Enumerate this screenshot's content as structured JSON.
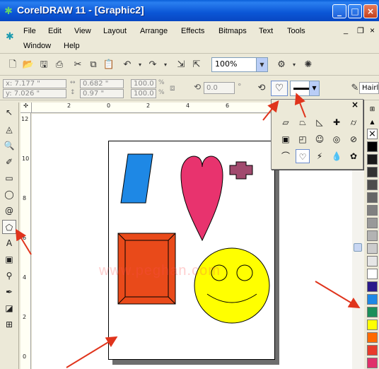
{
  "window": {
    "title": "CorelDRAW 11 - [Graphic2]",
    "minimize": "_",
    "maximize": "□",
    "close": "×"
  },
  "menu": [
    "File",
    "Edit",
    "View",
    "Layout",
    "Arrange",
    "Effects",
    "Bitmaps",
    "Text",
    "Tools",
    "Window",
    "Help"
  ],
  "mdi": {
    "minimize": "_",
    "restore": "❐",
    "close": "×"
  },
  "toolbar": {
    "zoom": "100%"
  },
  "props": {
    "x": "x: 7.177 \"",
    "y": "y: 7.026 \"",
    "w": "0.682 \"",
    "h": "0.97 \"",
    "sx": "100.0",
    "sy": "100.0",
    "pct1": "%",
    "pct2": "%",
    "angle": "0.0",
    "outline": "Hairli"
  },
  "flyout": {
    "close": "×"
  },
  "ruler_h": [
    "2",
    "0",
    "2",
    "4",
    "6"
  ],
  "ruler_v": [
    "12",
    "10",
    "8",
    "6",
    "4",
    "2",
    "0"
  ],
  "watermark": "www.peghan.com",
  "colors": {
    "accent": "#0b56d6",
    "palette": [
      "#000000",
      "#1a1a1a",
      "#333333",
      "#4d4d4d",
      "#666666",
      "#808080",
      "#999999",
      "#b3b3b3",
      "#cccccc",
      "#e6e6e6",
      "#ffffff",
      "#2a1a8a",
      "#1e88e5",
      "#1a8f5a",
      "#ffff00",
      "#ff6a00",
      "#e83a2a",
      "#e0306a",
      "#a04070",
      "#ff8c1a"
    ],
    "blue_parallelogram": "#1e88e5",
    "heart": "#e8336e",
    "cross": "#a14a6e",
    "rect": "#e94a1a",
    "smiley": "#ffff00",
    "arrows": "#e0341c"
  }
}
